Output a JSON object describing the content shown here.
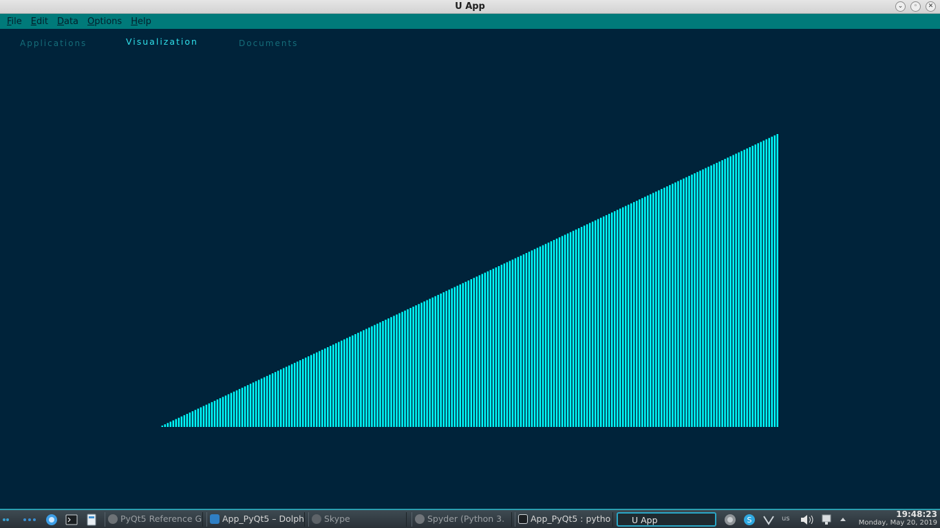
{
  "window": {
    "title": "U App"
  },
  "menubar": {
    "items": [
      "File",
      "Edit",
      "Data",
      "Options",
      "Help"
    ]
  },
  "tabs": [
    {
      "label": "Applications",
      "active": false
    },
    {
      "label": "Visualization",
      "active": true
    },
    {
      "label": "Documents",
      "active": false
    }
  ],
  "chart_data": {
    "type": "bar",
    "title": "",
    "xlabel": "",
    "ylabel": "",
    "bar_count": 224,
    "series": [
      {
        "values_rule": "linearly increasing",
        "first_value": 1,
        "last_value": 224,
        "step": 1
      }
    ],
    "x": {
      "start": 1,
      "end": 224
    },
    "ylim": [
      0,
      224
    ],
    "bar_color": "#00ffff",
    "grid": false,
    "axes_visible": false
  },
  "taskbar": {
    "tasks": [
      {
        "label": "PyQt5 Reference G",
        "icon": "browser-icon",
        "dim": true
      },
      {
        "label": "App_PyQt5 – Dolph",
        "icon": "folder-icon",
        "dim": false
      },
      {
        "label": "Skype",
        "icon": "skype-icon",
        "dim": true
      },
      {
        "label": "Spyder (Python 3.",
        "icon": "spyder-icon",
        "dim": true
      },
      {
        "label": "App_PyQt5 : pytho",
        "icon": "terminal-icon",
        "dim": false
      },
      {
        "label": "U App",
        "icon": "app-icon",
        "active": true
      }
    ],
    "tray": {
      "keyboard_layout": "us"
    },
    "clock": {
      "time": "19:48:23",
      "date": "Monday, May 20, 2019"
    }
  },
  "colors": {
    "background": "#00233a",
    "menubar": "#007a7a",
    "tab_active": "#2fe0ea",
    "tab_inactive": "#156d7a",
    "bars": "#00ffff"
  }
}
